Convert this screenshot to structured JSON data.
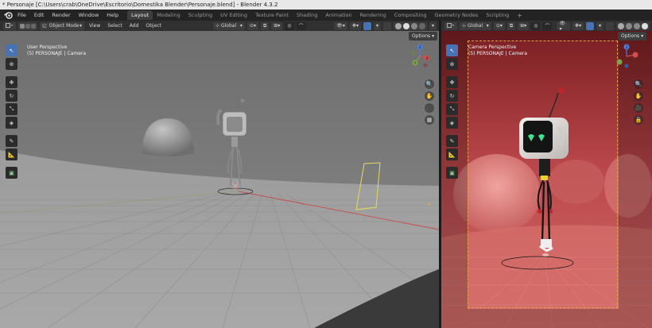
{
  "window": {
    "title": "* Personaje [C:\\Users\\crab\\OneDrive\\Escritorio\\Domestika Blender\\Personaje.blend] - Blender 4.3.2"
  },
  "menu": {
    "items": [
      "File",
      "Edit",
      "Render",
      "Window",
      "Help"
    ]
  },
  "workspaces": {
    "tabs": [
      "Layout",
      "Modeling",
      "Sculpting",
      "UV Editing",
      "Texture Paint",
      "Shading",
      "Animation",
      "Rendering",
      "Compositing",
      "Geometry Nodes",
      "Scripting"
    ],
    "active": "Layout",
    "add_label": "+"
  },
  "left_viewport": {
    "mode": "Object Mode",
    "menus": [
      "View",
      "Select",
      "Add",
      "Object"
    ],
    "transform_orientation": "Global",
    "options_label": "Options",
    "overlay_line1": "User Perspective",
    "overlay_line2": "(5) PERSONAJE | Camera"
  },
  "right_viewport": {
    "transform_orientation": "Global",
    "options_label": "Options",
    "overlay_line1": "Camera Perspective",
    "overlay_line2": "(5) PERSONAJE | Camera"
  },
  "colors": {
    "accent": "#4772b3",
    "camera_frame": "#e0a24a",
    "grid_red": "#c64c4c",
    "grid_green": "#7ea44a",
    "render_bg": "#c9595a"
  }
}
